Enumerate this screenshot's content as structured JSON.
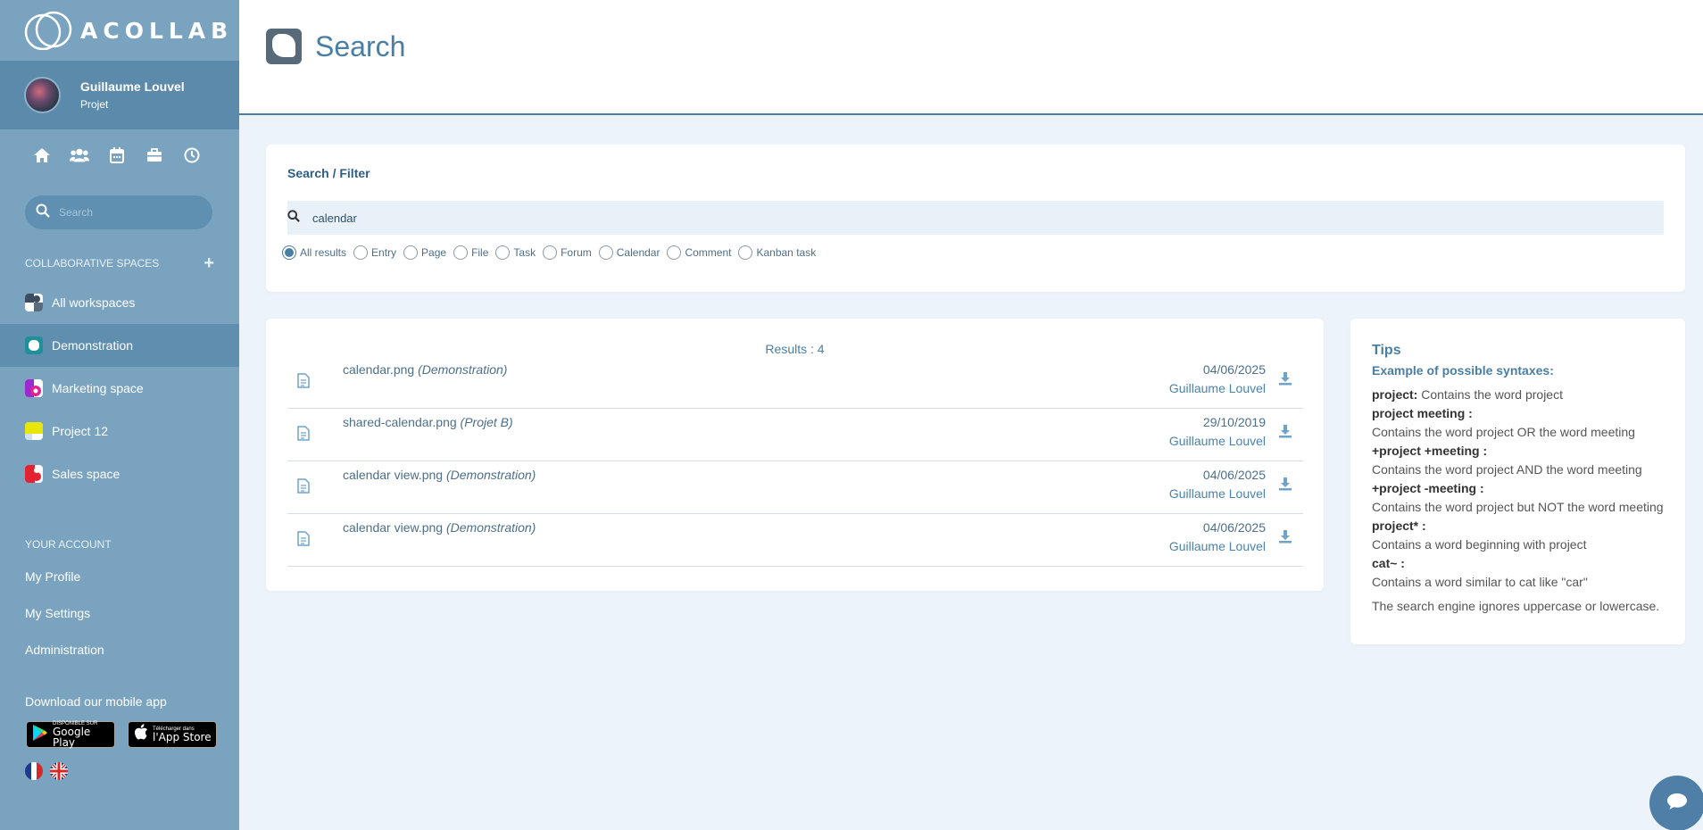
{
  "brand": {
    "name": "ACOLLAB"
  },
  "user": {
    "name": "Guillaume Louvel",
    "role": "Projet"
  },
  "quick_nav": [
    "home-icon",
    "users-icon",
    "calendar-icon",
    "briefcase-icon",
    "clock-icon"
  ],
  "sidebar_search": {
    "placeholder": "Search"
  },
  "spaces": {
    "heading": "COLLABORATIVE SPACES",
    "items": [
      {
        "label": "All workspaces"
      },
      {
        "label": "Demonstration"
      },
      {
        "label": "Marketing space"
      },
      {
        "label": "Project 12"
      },
      {
        "label": "Sales space"
      }
    ]
  },
  "account": {
    "heading": "YOUR ACCOUNT",
    "items": [
      {
        "label": "My Profile"
      },
      {
        "label": "My Settings"
      },
      {
        "label": "Administration"
      }
    ]
  },
  "mobile": {
    "title": "Download our mobile app",
    "google_small": "DISPONIBLE SUR",
    "google_big": "Google Play",
    "apple_small": "Télécharger dans",
    "apple_big": "l'App Store"
  },
  "page": {
    "title": "Search"
  },
  "filter": {
    "title": "Search / Filter",
    "query": "calendar",
    "options": [
      "All results",
      "Entry",
      "Page",
      "File",
      "Task",
      "Forum",
      "Calendar",
      "Comment",
      "Kanban task"
    ],
    "selected": "All results"
  },
  "results": {
    "count_label": "Results : 4",
    "items": [
      {
        "name": "calendar.png",
        "space": "(Demonstration)",
        "date": "04/06/2025",
        "author": "Guillaume Louvel"
      },
      {
        "name": "shared-calendar.png",
        "space": "(Projet B)",
        "date": "29/10/2019",
        "author": "Guillaume Louvel"
      },
      {
        "name": "calendar view.png",
        "space": "(Demonstration)",
        "date": "04/06/2025",
        "author": "Guillaume Louvel"
      },
      {
        "name": "calendar view.png",
        "space": "(Demonstration)",
        "date": "04/06/2025",
        "author": "Guillaume Louvel"
      }
    ]
  },
  "tips": {
    "title": "Tips",
    "subtitle": "Example of possible syntaxes:",
    "lines": [
      {
        "term": "project:",
        "desc": " Contains the word project"
      },
      {
        "term": "project meeting :",
        "desc": ""
      },
      {
        "term": "",
        "desc": "Contains the word project OR the word meeting"
      },
      {
        "term": "+project +meeting :",
        "desc": ""
      },
      {
        "term": "",
        "desc": "Contains the word project AND the word meeting"
      },
      {
        "term": "+project -meeting :",
        "desc": ""
      },
      {
        "term": "",
        "desc": "Contains the word project but NOT the word meeting"
      },
      {
        "term": "project* :",
        "desc": ""
      },
      {
        "term": "",
        "desc": "Contains a word beginning with project"
      },
      {
        "term": "cat~ :",
        "desc": ""
      },
      {
        "term": "",
        "desc": "Contains a word similar to cat like \"car\""
      }
    ],
    "footer": "The search engine ignores uppercase or lowercase."
  },
  "colors": {
    "sidebar": "#7aa3bf",
    "active": "#5f8eae",
    "accent": "#4a7ea3",
    "background": "#edf3fa"
  }
}
